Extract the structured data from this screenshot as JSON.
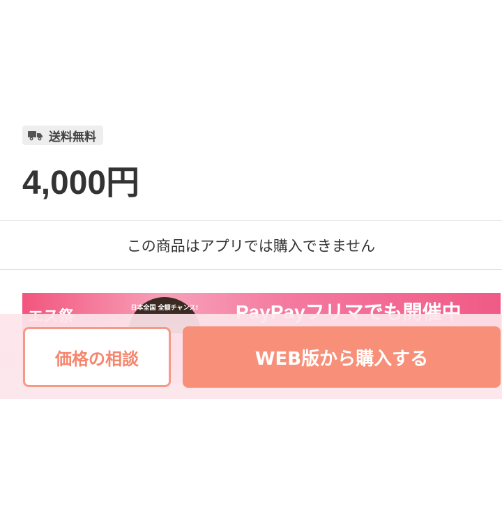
{
  "shipping": {
    "icon": "truck-icon",
    "label": "送料無料"
  },
  "price": {
    "text": "4,000円"
  },
  "notice": {
    "text": "この商品はアプリでは購入できません"
  },
  "banner": {
    "left_text": "エス祭",
    "badge_text": "日本全国 全額チャンス!",
    "title": "PayPayフリマでも開催中"
  },
  "actions": {
    "negotiate_label": "価格の相談",
    "buy_web_label": "WEB版から購入する"
  },
  "colors": {
    "accent": "#f89079",
    "accent_border": "#f59a84",
    "bottom_bar_bg": "#fce6ec",
    "badge_bg": "#eeeeee"
  }
}
